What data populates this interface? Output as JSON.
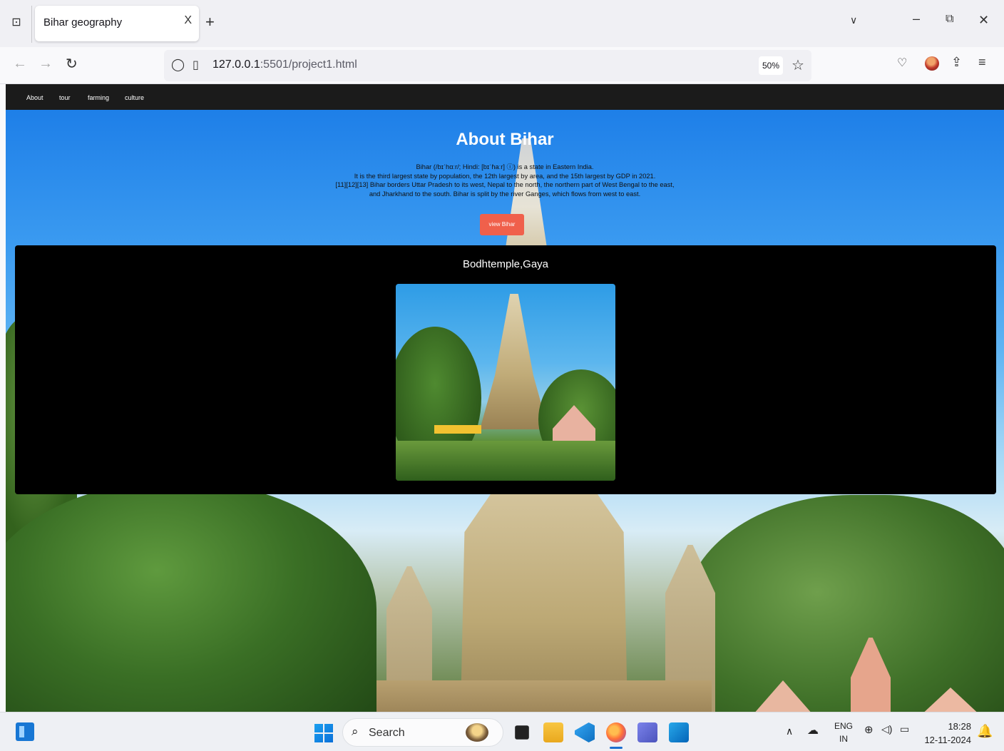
{
  "browser": {
    "tab_title": "Bihar geography",
    "tab_close": "X",
    "new_tab": "+",
    "url_host": "127.0.0.1",
    "url_rest": ":5501/project1.html",
    "zoom": "50%"
  },
  "site": {
    "nav": [
      "About",
      "tour",
      "farming",
      "culture"
    ],
    "hero_title": "About Bihar",
    "hero_lines": [
      "Bihar (/bɪˈhɑːr/; Hindi: [bɪˈɦaːr] ⓘ) is a state in Eastern India.",
      "It is the third largest state by population, the 12th largest by area, and the 15th largest by GDP in 2021.",
      "[11][12][13] Bihar borders Uttar Pradesh to its west, Nepal to the north, the northern part of West Bengal to the east,",
      "and Jharkhand to the south. Bihar is split by the river Ganges, which flows from west to east."
    ],
    "view_button": "view Bihar",
    "card_title": "Bodhtemple,Gaya"
  },
  "taskbar": {
    "search_placeholder": "Search",
    "lang_top": "ENG",
    "lang_bottom": "IN",
    "time": "18:28",
    "date": "12-11-2024"
  },
  "colors": {
    "nav_bg": "#1b1b1b",
    "button": "#f0604b",
    "card_bg": "#000000"
  }
}
